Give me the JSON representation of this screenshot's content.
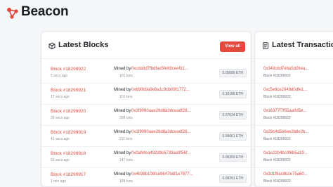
{
  "app": {
    "brand": "Beacon",
    "logo_icon": "network-nodes-icon",
    "accent": "#e5483d"
  },
  "blocks_panel": {
    "title": "Latest Blocks",
    "title_icon": "cube-icon",
    "view_all_label": "View all",
    "mined_by_label": "Mined by",
    "rows": [
      {
        "block": "Block #18299922",
        "age": "5 secs ago",
        "miner": "0xcda9d7fbdfae5fe69ceef31...",
        "txns": "101 txns",
        "reward": "0.05086 ETH"
      },
      {
        "block": "Block #18299921",
        "age": "17 secs ago",
        "miner": "0x690b9a9e8a1c9db09f1772...",
        "txns": "110 txns",
        "reward": "0.10186 ETH"
      },
      {
        "block": "Block #18299920",
        "age": "29 secs ago",
        "miner": "0x1f9090aae28d8a3dceadf28...",
        "txns": "208 txns",
        "reward": "0.07634 ETH"
      },
      {
        "block": "Block #18299919",
        "age": "41 secs ago",
        "miner": "0x1f9090aae28d8a3dceadf28...",
        "txns": "211 txns",
        "reward": "0.09661 ETH"
      },
      {
        "block": "Block #18299918",
        "age": "53 secs ago",
        "miner": "0x0afefea492d9c6733ae3f56f...",
        "txns": "147 txns",
        "reward": "0.06359 ETH"
      },
      {
        "block": "Block #18299917",
        "age": "1 min ago",
        "miner": "0x4838b106fce9647bdf1e7877...",
        "txns": "169 txns",
        "reward": "0.08291 ETH"
      }
    ]
  },
  "tx_panel": {
    "title": "Latest Transactions",
    "title_icon": "document-icon",
    "rows": [
      {
        "hash": "0x343c6d7e6a5d26ea...",
        "block": "Block #18299922"
      },
      {
        "hash": "0xc5e8ce2049d0dfe1...",
        "block": "Block #18299922"
      },
      {
        "hash": "0x16377f7f55aa0d5e...",
        "block": "Block #18299922"
      },
      {
        "hash": "0x29c4d5b6ee2b8e2b...",
        "block": "Block #18299922"
      },
      {
        "hash": "0x1e22b4bc0f6b5a19...",
        "block": "Block #18299922"
      },
      {
        "hash": "0x3d1f9ac8b2e75a60...",
        "block": "Block #18299922"
      }
    ]
  }
}
